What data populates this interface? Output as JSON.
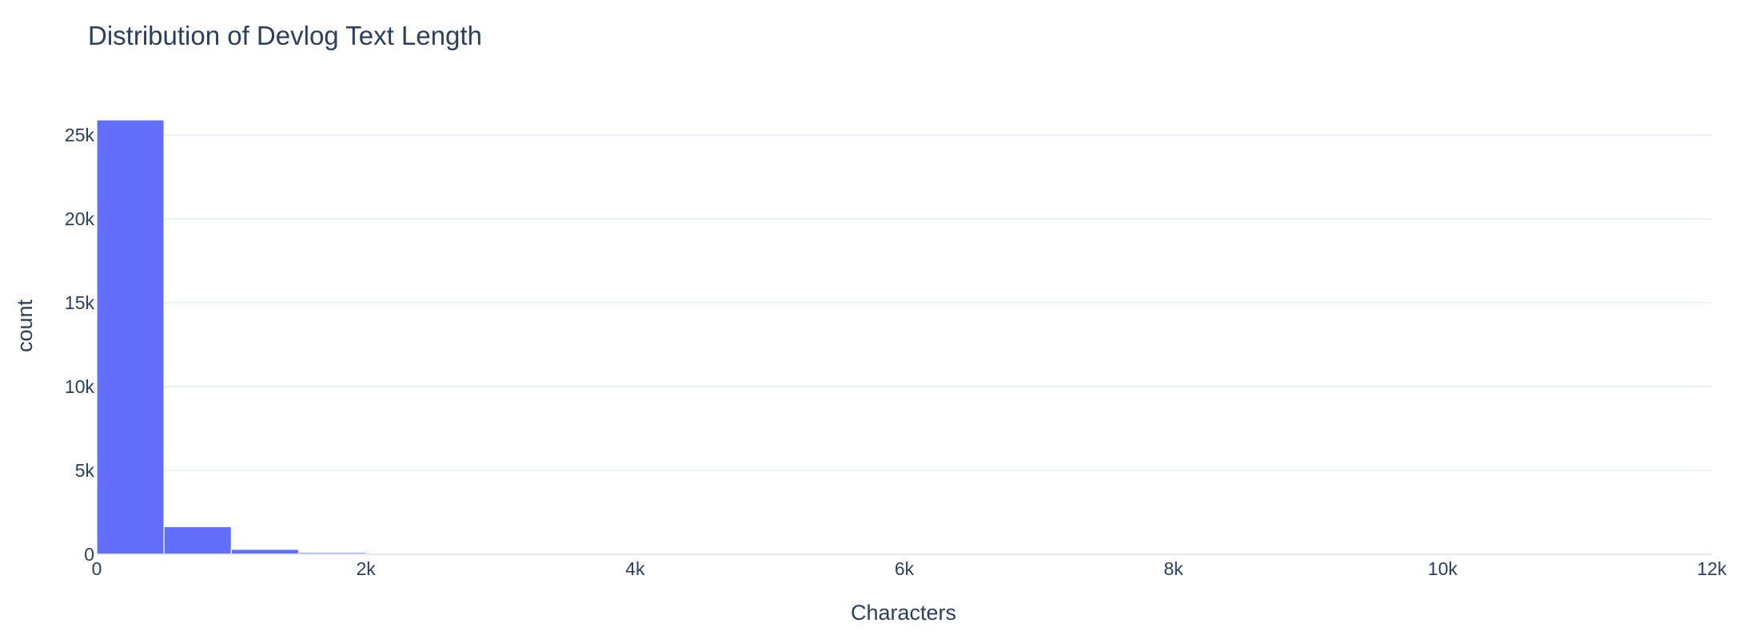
{
  "chart_data": {
    "type": "bar",
    "title": "Distribution of Devlog Text Length",
    "xlabel": "Characters",
    "ylabel": "count",
    "xlim": [
      0,
      12000
    ],
    "ylim": [
      0,
      26000
    ],
    "bin_width": 500,
    "bins": [
      {
        "start": 0,
        "end": 500,
        "count": 25900
      },
      {
        "start": 500,
        "end": 1000,
        "count": 1650
      },
      {
        "start": 1000,
        "end": 1500,
        "count": 300
      },
      {
        "start": 1500,
        "end": 2000,
        "count": 110
      },
      {
        "start": 2000,
        "end": 2500,
        "count": 45
      },
      {
        "start": 2500,
        "end": 3000,
        "count": 20
      },
      {
        "start": 3000,
        "end": 3500,
        "count": 10
      },
      {
        "start": 3500,
        "end": 4000,
        "count": 6
      },
      {
        "start": 4000,
        "end": 4500,
        "count": 4
      },
      {
        "start": 4500,
        "end": 5000,
        "count": 3
      },
      {
        "start": 5000,
        "end": 5500,
        "count": 2
      },
      {
        "start": 5500,
        "end": 6000,
        "count": 2
      },
      {
        "start": 6000,
        "end": 6500,
        "count": 1
      },
      {
        "start": 6500,
        "end": 7000,
        "count": 1
      },
      {
        "start": 7000,
        "end": 7500,
        "count": 1
      },
      {
        "start": 7500,
        "end": 8000,
        "count": 1
      },
      {
        "start": 8000,
        "end": 8500,
        "count": 1
      },
      {
        "start": 8500,
        "end": 9000,
        "count": 1
      },
      {
        "start": 9000,
        "end": 9500,
        "count": 1
      },
      {
        "start": 9500,
        "end": 10000,
        "count": 1
      },
      {
        "start": 10000,
        "end": 10500,
        "count": 1
      },
      {
        "start": 10500,
        "end": 11000,
        "count": 1
      },
      {
        "start": 11000,
        "end": 11500,
        "count": 1
      },
      {
        "start": 11500,
        "end": 12000,
        "count": 1
      }
    ],
    "x_ticks": [
      {
        "value": 0,
        "label": "0"
      },
      {
        "value": 2000,
        "label": "2k"
      },
      {
        "value": 4000,
        "label": "4k"
      },
      {
        "value": 6000,
        "label": "6k"
      },
      {
        "value": 8000,
        "label": "8k"
      },
      {
        "value": 10000,
        "label": "10k"
      },
      {
        "value": 12000,
        "label": "12k"
      }
    ],
    "y_ticks": [
      {
        "value": 0,
        "label": "0"
      },
      {
        "value": 5000,
        "label": "5k"
      },
      {
        "value": 10000,
        "label": "10k"
      },
      {
        "value": 15000,
        "label": "15k"
      },
      {
        "value": 20000,
        "label": "20k"
      },
      {
        "value": 25000,
        "label": "25k"
      }
    ],
    "grid": "horizontal",
    "legend": "none",
    "colors": {
      "bar": "#636efa",
      "grid": "#e5ecf6",
      "text": "#2a3f5f",
      "bar_edge": "#ffffff"
    }
  }
}
